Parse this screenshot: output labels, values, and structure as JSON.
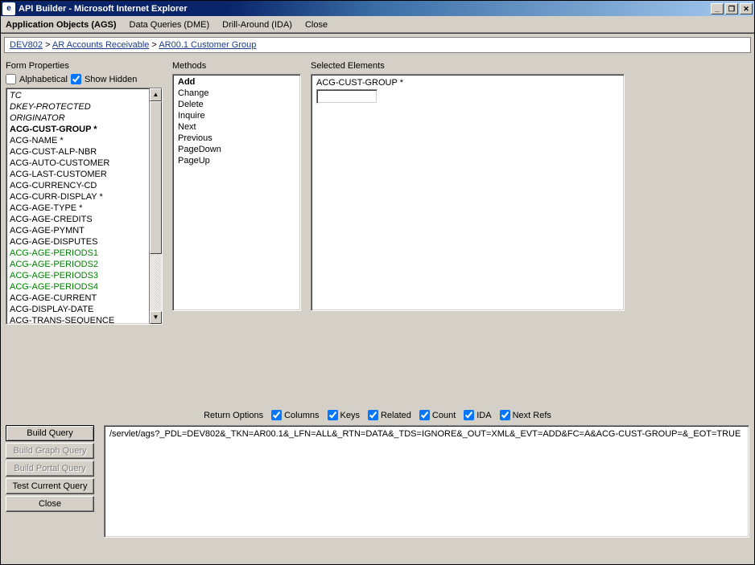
{
  "window": {
    "title": "API Builder - Microsoft Internet Explorer"
  },
  "menubar": {
    "items": [
      "Application Objects (AGS)",
      "Data Queries (DME)",
      "Drill-Around (IDA)",
      "Close"
    ],
    "active_index": 0
  },
  "breadcrumb": {
    "items": [
      "DEV802",
      "AR Accounts Receivable",
      "AR00.1 Customer Group"
    ],
    "separator": " > "
  },
  "form_properties": {
    "label": "Form Properties",
    "checkboxes": {
      "alphabetical": {
        "label": "Alphabetical",
        "checked": false
      },
      "show_hidden": {
        "label": "Show Hidden",
        "checked": true
      }
    },
    "items": [
      {
        "text": "TC",
        "style": "italic"
      },
      {
        "text": "DKEY-PROTECTED",
        "style": "italic"
      },
      {
        "text": "ORIGINATOR",
        "style": "italic"
      },
      {
        "text": "ACG-CUST-GROUP *",
        "style": "bold"
      },
      {
        "text": "ACG-NAME *",
        "style": ""
      },
      {
        "text": "ACG-CUST-ALP-NBR",
        "style": ""
      },
      {
        "text": "ACG-AUTO-CUSTOMER",
        "style": ""
      },
      {
        "text": "ACG-LAST-CUSTOMER",
        "style": ""
      },
      {
        "text": "ACG-CURRENCY-CD",
        "style": ""
      },
      {
        "text": "ACG-CURR-DISPLAY *",
        "style": ""
      },
      {
        "text": "ACG-AGE-TYPE *",
        "style": ""
      },
      {
        "text": "ACG-AGE-CREDITS",
        "style": ""
      },
      {
        "text": "ACG-AGE-PYMNT",
        "style": ""
      },
      {
        "text": "ACG-AGE-DISPUTES",
        "style": ""
      },
      {
        "text": "ACG-AGE-PERIODS1",
        "style": "green"
      },
      {
        "text": "ACG-AGE-PERIODS2",
        "style": "green"
      },
      {
        "text": "ACG-AGE-PERIODS3",
        "style": "green"
      },
      {
        "text": "ACG-AGE-PERIODS4",
        "style": "green"
      },
      {
        "text": "ACG-AGE-CURRENT",
        "style": ""
      },
      {
        "text": "ACG-DISPLAY-DATE",
        "style": ""
      },
      {
        "text": "ACG-TRANS-SEQUENCE",
        "style": ""
      }
    ]
  },
  "methods": {
    "label": "Methods",
    "items": [
      "Add",
      "Change",
      "Delete",
      "Inquire",
      "Next",
      "Previous",
      "PageDown",
      "PageUp"
    ],
    "selected": "Add"
  },
  "selected_elements": {
    "label": "Selected Elements",
    "items": [
      {
        "text": "ACG-CUST-GROUP *",
        "value": ""
      }
    ]
  },
  "return_options": {
    "label": "Return Options",
    "items": [
      {
        "label": "Columns",
        "checked": true
      },
      {
        "label": "Keys",
        "checked": true
      },
      {
        "label": "Related",
        "checked": true
      },
      {
        "label": "Count",
        "checked": true
      },
      {
        "label": "IDA",
        "checked": true
      },
      {
        "label": "Next Refs",
        "checked": true
      }
    ]
  },
  "buttons": {
    "build_query": "Build Query",
    "build_graph_query": "Build Graph Query",
    "build_portal_query": "Build Portal Query",
    "test_current_query": "Test Current Query",
    "close": "Close"
  },
  "query_output": "/servlet/ags?_PDL=DEV802&_TKN=AR00.1&_LFN=ALL&_RTN=DATA&_TDS=IGNORE&_OUT=XML&_EVT=ADD&FC=A&ACG-CUST-GROUP=&_EOT=TRUE",
  "win_controls": {
    "minimize": "_",
    "restore": "❐",
    "close": "✕"
  }
}
